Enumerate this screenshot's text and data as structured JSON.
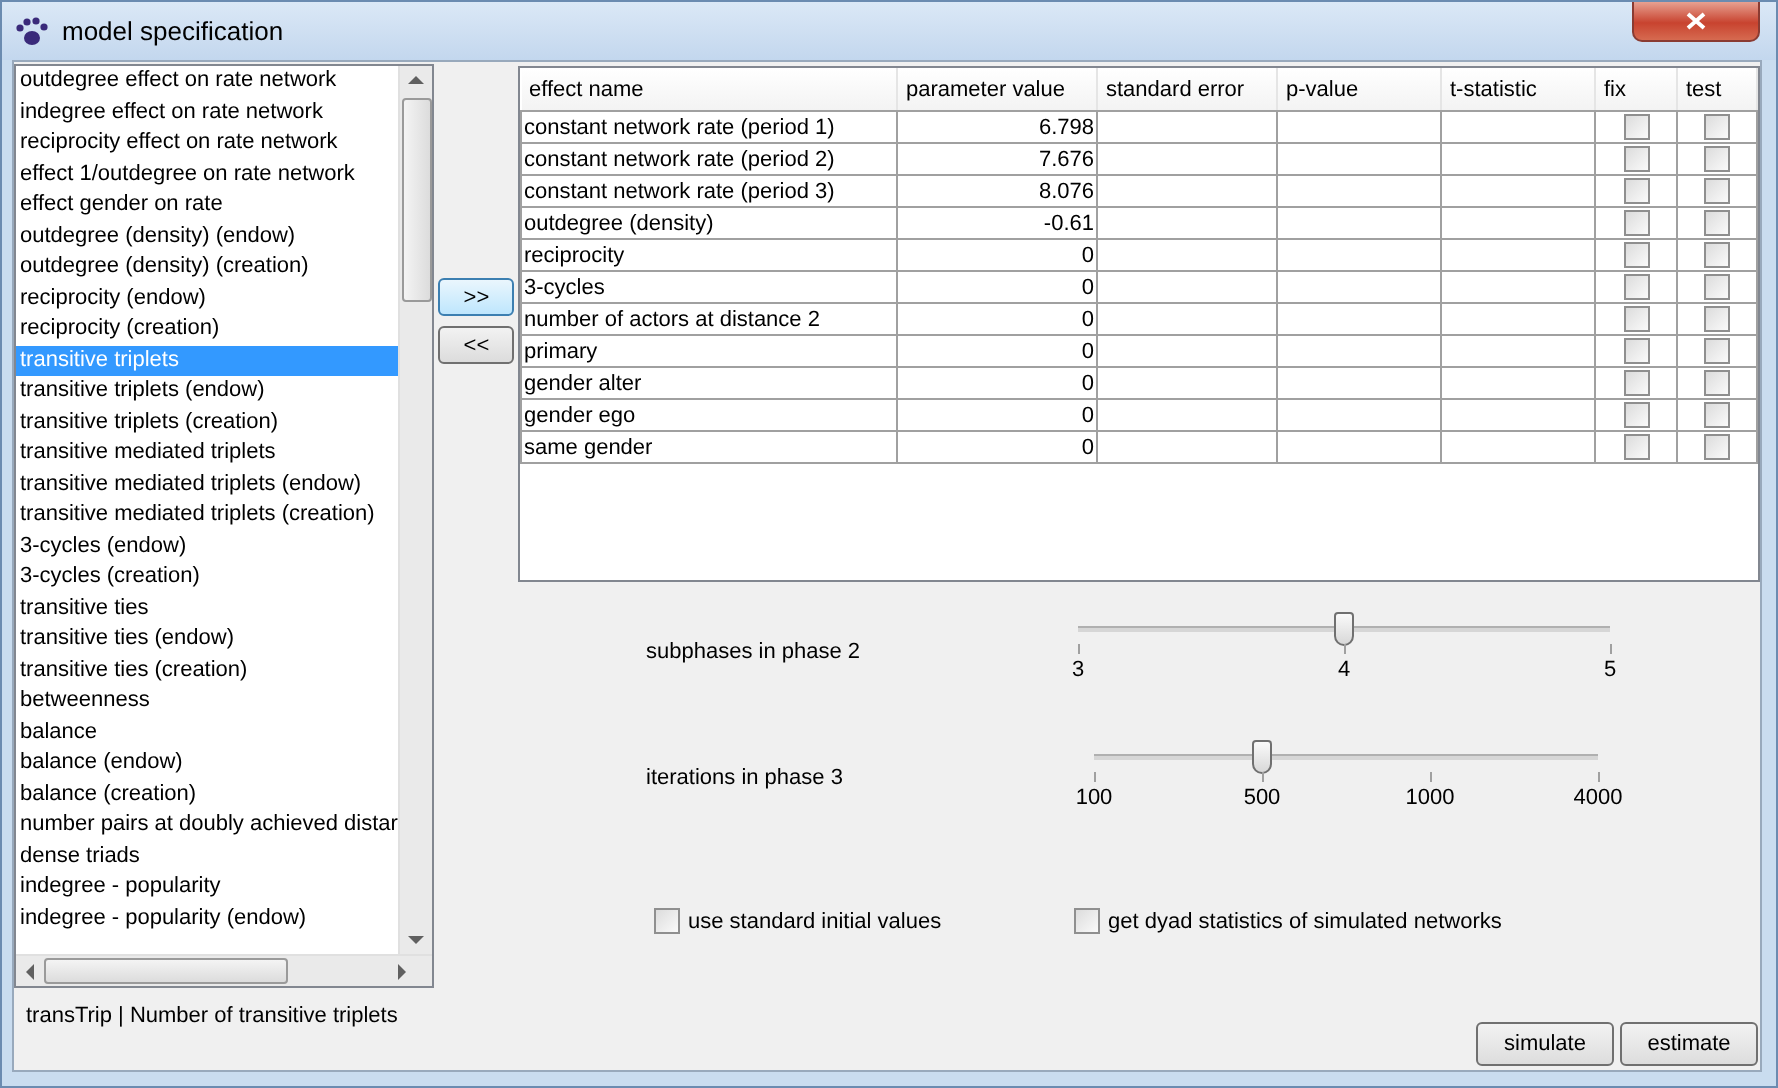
{
  "window": {
    "title": "model specification"
  },
  "effects_list": {
    "items": [
      {
        "label": "outdegree effect on rate network",
        "selected": false
      },
      {
        "label": "indegree effect on rate network",
        "selected": false
      },
      {
        "label": "reciprocity effect on rate network",
        "selected": false
      },
      {
        "label": "effect 1/outdegree on rate network",
        "selected": false
      },
      {
        "label": "effect gender on rate",
        "selected": false
      },
      {
        "label": "outdegree (density) (endow)",
        "selected": false
      },
      {
        "label": "outdegree (density) (creation)",
        "selected": false
      },
      {
        "label": "reciprocity (endow)",
        "selected": false
      },
      {
        "label": "reciprocity (creation)",
        "selected": false
      },
      {
        "label": "transitive triplets",
        "selected": true
      },
      {
        "label": "transitive triplets (endow)",
        "selected": false
      },
      {
        "label": "transitive triplets (creation)",
        "selected": false
      },
      {
        "label": "transitive mediated triplets",
        "selected": false
      },
      {
        "label": "transitive mediated triplets (endow)",
        "selected": false
      },
      {
        "label": "transitive mediated triplets (creation)",
        "selected": false
      },
      {
        "label": "3-cycles (endow)",
        "selected": false
      },
      {
        "label": "3-cycles (creation)",
        "selected": false
      },
      {
        "label": "transitive ties",
        "selected": false
      },
      {
        "label": "transitive ties (endow)",
        "selected": false
      },
      {
        "label": "transitive ties (creation)",
        "selected": false
      },
      {
        "label": "betweenness",
        "selected": false
      },
      {
        "label": "balance",
        "selected": false
      },
      {
        "label": "balance (endow)",
        "selected": false
      },
      {
        "label": "balance (creation)",
        "selected": false
      },
      {
        "label": "number pairs at doubly achieved distar",
        "selected": false
      },
      {
        "label": "dense triads",
        "selected": false
      },
      {
        "label": "indegree - popularity",
        "selected": false
      },
      {
        "label": "indegree - popularity (endow)",
        "selected": false
      }
    ]
  },
  "status": "transTrip | Number of transitive triplets",
  "move_buttons": [
    {
      "label": ">>",
      "highlighted": true
    },
    {
      "label": "<<",
      "highlighted": false
    }
  ],
  "table": {
    "columns": [
      "effect name",
      "parameter value",
      "standard error",
      "p-value",
      "t-statistic",
      "fix",
      "test"
    ],
    "rows": [
      {
        "effect_name": "constant network rate (period 1)",
        "parameter_value": "6.798",
        "fix": false,
        "test": false
      },
      {
        "effect_name": "constant network rate (period 2)",
        "parameter_value": "7.676",
        "fix": false,
        "test": false
      },
      {
        "effect_name": "constant network rate (period 3)",
        "parameter_value": "8.076",
        "fix": false,
        "test": false
      },
      {
        "effect_name": "outdegree (density)",
        "parameter_value": "-0.61",
        "fix": false,
        "test": false
      },
      {
        "effect_name": "reciprocity",
        "parameter_value": "0",
        "fix": false,
        "test": false
      },
      {
        "effect_name": "3-cycles",
        "parameter_value": "0",
        "fix": false,
        "test": false
      },
      {
        "effect_name": "number of actors at distance 2",
        "parameter_value": "0",
        "fix": false,
        "test": false
      },
      {
        "effect_name": "primary",
        "parameter_value": "0",
        "fix": false,
        "test": false
      },
      {
        "effect_name": "gender alter",
        "parameter_value": "0",
        "fix": false,
        "test": false
      },
      {
        "effect_name": "gender ego",
        "parameter_value": "0",
        "fix": false,
        "test": false
      },
      {
        "effect_name": "same gender",
        "parameter_value": "0",
        "fix": false,
        "test": false
      }
    ]
  },
  "sliders": [
    {
      "label": "subphases in phase 2",
      "ticks": [
        "3",
        "4",
        "5"
      ],
      "level": 0.5
    },
    {
      "label": "iterations in phase 3",
      "ticks": [
        "100",
        "500",
        "1000",
        "4000"
      ],
      "level": 0.3333
    }
  ],
  "options": [
    {
      "label": "use standard initial values",
      "checked": false
    },
    {
      "label": "get dyad statistics of simulated networks",
      "checked": false
    }
  ],
  "buttons": [
    "simulate",
    "estimate"
  ]
}
